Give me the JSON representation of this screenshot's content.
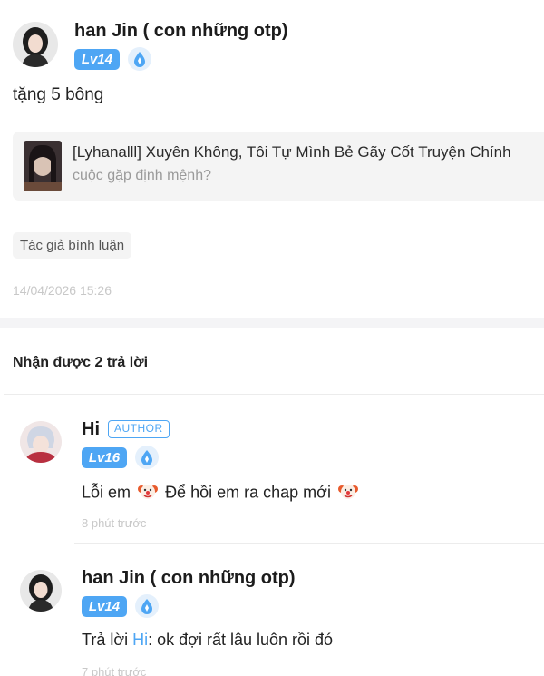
{
  "comment": {
    "user_name": "han Jin ( con những otp)",
    "level": "Lv14",
    "text": "tặng 5 bông",
    "book": {
      "title": "[Lyhanalll] Xuyên Không, Tôi Tự Mình Bẻ Gãy Cốt Truyện Chính",
      "subtitle": "cuộc gặp định mệnh?"
    },
    "author_chip": "Tác giả bình luận",
    "timestamp": "14/04/2026 15:26"
  },
  "replies_heading": "Nhận được 2 trả lời",
  "replies": [
    {
      "user_name": "Hi",
      "tag": "AUTHOR",
      "level": "Lv16",
      "text_part1": "Lỗi em",
      "text_part2": "Để hồi em ra chap mới",
      "time": "8 phút trước"
    },
    {
      "user_name": "han Jin ( con những otp)",
      "level": "Lv14",
      "reply_prefix": "Trả lời",
      "mention": "Hi",
      "text": ": ok đợi rất lâu luôn rồi đó",
      "time": "7 phút trước"
    }
  ],
  "colors": {
    "accent": "#4ea6f4",
    "muted": "#c8c8c8",
    "card_bg": "#f4f4f4"
  },
  "icons": [
    "water-drop-icon",
    "clown-emoji-icon"
  ]
}
